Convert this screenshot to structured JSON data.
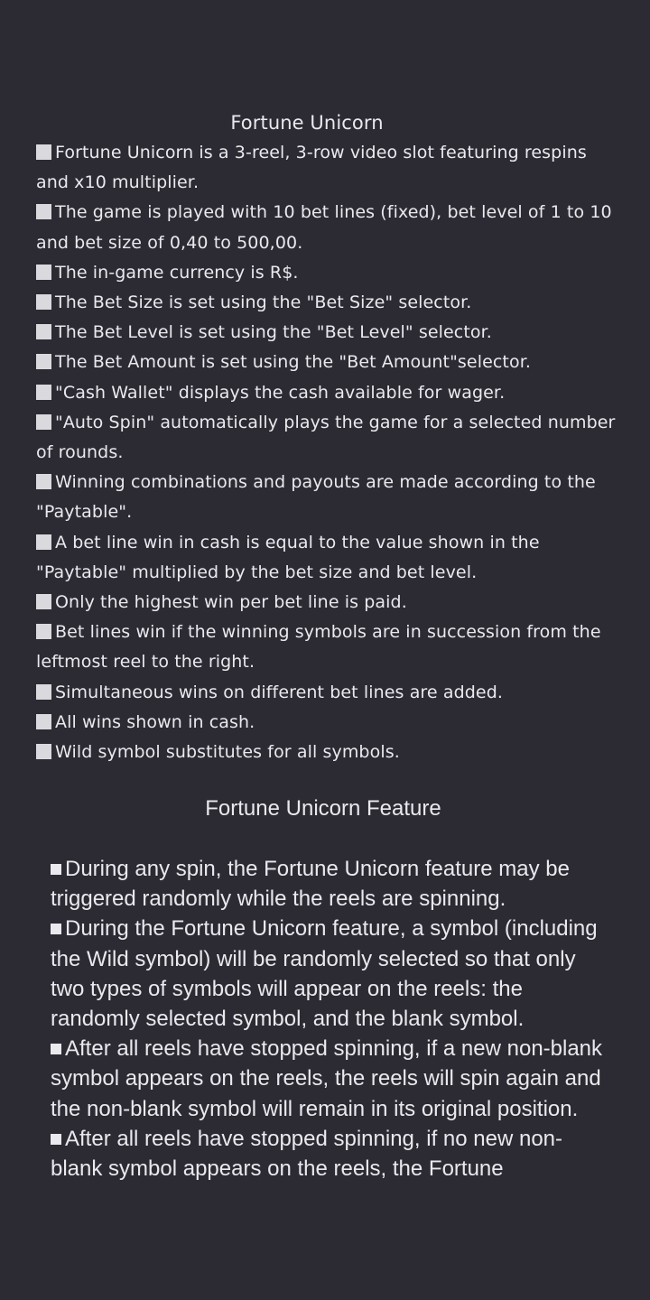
{
  "rules": {
    "title": "Fortune Unicorn",
    "items": [
      "Fortune Unicorn is a 3-reel, 3-row video slot featuring respins and x10 multiplier.",
      "The game is played with 10 bet lines (fixed), bet level of 1 to 10 and bet size of 0,40 to 500,00.",
      "The in-game currency is R$.",
      "The Bet Size is set using the \"Bet Size\" selector.",
      "The Bet Level is set using the \"Bet Level\" selector.",
      "The Bet Amount is set using the \"Bet Amount\"selector.",
      "\"Cash Wallet\" displays the cash available for wager.",
      "\"Auto Spin\" automatically plays the game for a selected number of rounds.",
      "Winning combinations and payouts are made according to the \"Paytable\".",
      "A bet line win in cash is equal to the value shown in the \"Paytable\" multiplied by the bet size and bet level.",
      "Only the highest win per bet line is paid.",
      "Bet lines win if the winning symbols are in succession from the leftmost reel to the right.",
      "Simultaneous wins on different bet lines are added.",
      "All wins shown in cash.",
      "Wild symbol substitutes for all symbols."
    ]
  },
  "feature": {
    "title": "Fortune Unicorn Feature",
    "items": [
      "During any spin, the Fortune Unicorn feature may be triggered randomly while the reels are spinning.",
      "During the Fortune Unicorn feature, a symbol (including the Wild symbol) will be randomly selected so that only two types of symbols will appear on the reels: the randomly selected symbol, and the blank symbol.",
      "After all reels have stopped spinning, if a new non-blank symbol appears on the reels, the reels will spin again and the non-blank symbol will remain in its original position.",
      "After all reels have stopped spinning, if no new non-blank symbol appears on the reels, the Fortune"
    ]
  }
}
